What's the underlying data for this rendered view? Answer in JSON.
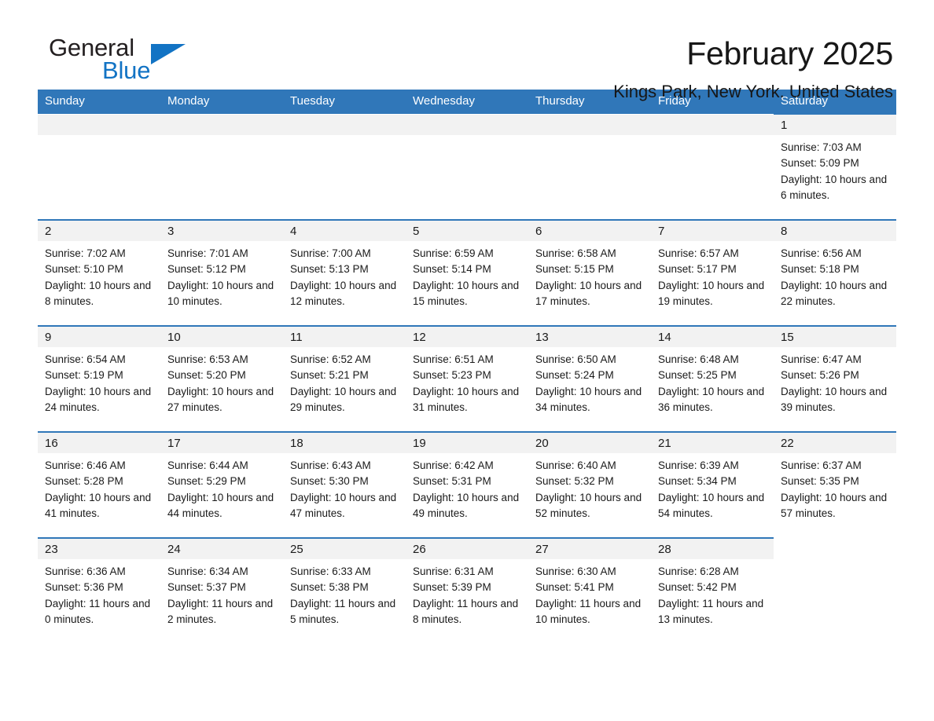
{
  "brand": {
    "name_part1": "General",
    "name_part2": "Blue",
    "accent_color": "#1273c4",
    "header_color": "#3077b9"
  },
  "header": {
    "title": "February 2025",
    "subtitle": "Kings Park, New York, United States"
  },
  "weekdays": [
    "Sunday",
    "Monday",
    "Tuesday",
    "Wednesday",
    "Thursday",
    "Friday",
    "Saturday"
  ],
  "labels": {
    "sunrise_prefix": "Sunrise:",
    "sunset_prefix": "Sunset:",
    "daylight_prefix": "Daylight:"
  },
  "weeks": [
    [
      {
        "day": "",
        "sunrise": "",
        "sunset": "",
        "daylight": "",
        "blank": true
      },
      {
        "day": "",
        "sunrise": "",
        "sunset": "",
        "daylight": "",
        "blank": true
      },
      {
        "day": "",
        "sunrise": "",
        "sunset": "",
        "daylight": "",
        "blank": true
      },
      {
        "day": "",
        "sunrise": "",
        "sunset": "",
        "daylight": "",
        "blank": true
      },
      {
        "day": "",
        "sunrise": "",
        "sunset": "",
        "daylight": "",
        "blank": true
      },
      {
        "day": "",
        "sunrise": "",
        "sunset": "",
        "daylight": "",
        "blank": true
      },
      {
        "day": "1",
        "sunrise": "Sunrise: 7:03 AM",
        "sunset": "Sunset: 5:09 PM",
        "daylight": "Daylight: 10 hours and 6 minutes."
      }
    ],
    [
      {
        "day": "2",
        "sunrise": "Sunrise: 7:02 AM",
        "sunset": "Sunset: 5:10 PM",
        "daylight": "Daylight: 10 hours and 8 minutes."
      },
      {
        "day": "3",
        "sunrise": "Sunrise: 7:01 AM",
        "sunset": "Sunset: 5:12 PM",
        "daylight": "Daylight: 10 hours and 10 minutes."
      },
      {
        "day": "4",
        "sunrise": "Sunrise: 7:00 AM",
        "sunset": "Sunset: 5:13 PM",
        "daylight": "Daylight: 10 hours and 12 minutes."
      },
      {
        "day": "5",
        "sunrise": "Sunrise: 6:59 AM",
        "sunset": "Sunset: 5:14 PM",
        "daylight": "Daylight: 10 hours and 15 minutes."
      },
      {
        "day": "6",
        "sunrise": "Sunrise: 6:58 AM",
        "sunset": "Sunset: 5:15 PM",
        "daylight": "Daylight: 10 hours and 17 minutes."
      },
      {
        "day": "7",
        "sunrise": "Sunrise: 6:57 AM",
        "sunset": "Sunset: 5:17 PM",
        "daylight": "Daylight: 10 hours and 19 minutes."
      },
      {
        "day": "8",
        "sunrise": "Sunrise: 6:56 AM",
        "sunset": "Sunset: 5:18 PM",
        "daylight": "Daylight: 10 hours and 22 minutes."
      }
    ],
    [
      {
        "day": "9",
        "sunrise": "Sunrise: 6:54 AM",
        "sunset": "Sunset: 5:19 PM",
        "daylight": "Daylight: 10 hours and 24 minutes."
      },
      {
        "day": "10",
        "sunrise": "Sunrise: 6:53 AM",
        "sunset": "Sunset: 5:20 PM",
        "daylight": "Daylight: 10 hours and 27 minutes."
      },
      {
        "day": "11",
        "sunrise": "Sunrise: 6:52 AM",
        "sunset": "Sunset: 5:21 PM",
        "daylight": "Daylight: 10 hours and 29 minutes."
      },
      {
        "day": "12",
        "sunrise": "Sunrise: 6:51 AM",
        "sunset": "Sunset: 5:23 PM",
        "daylight": "Daylight: 10 hours and 31 minutes."
      },
      {
        "day": "13",
        "sunrise": "Sunrise: 6:50 AM",
        "sunset": "Sunset: 5:24 PM",
        "daylight": "Daylight: 10 hours and 34 minutes."
      },
      {
        "day": "14",
        "sunrise": "Sunrise: 6:48 AM",
        "sunset": "Sunset: 5:25 PM",
        "daylight": "Daylight: 10 hours and 36 minutes."
      },
      {
        "day": "15",
        "sunrise": "Sunrise: 6:47 AM",
        "sunset": "Sunset: 5:26 PM",
        "daylight": "Daylight: 10 hours and 39 minutes."
      }
    ],
    [
      {
        "day": "16",
        "sunrise": "Sunrise: 6:46 AM",
        "sunset": "Sunset: 5:28 PM",
        "daylight": "Daylight: 10 hours and 41 minutes."
      },
      {
        "day": "17",
        "sunrise": "Sunrise: 6:44 AM",
        "sunset": "Sunset: 5:29 PM",
        "daylight": "Daylight: 10 hours and 44 minutes."
      },
      {
        "day": "18",
        "sunrise": "Sunrise: 6:43 AM",
        "sunset": "Sunset: 5:30 PM",
        "daylight": "Daylight: 10 hours and 47 minutes."
      },
      {
        "day": "19",
        "sunrise": "Sunrise: 6:42 AM",
        "sunset": "Sunset: 5:31 PM",
        "daylight": "Daylight: 10 hours and 49 minutes."
      },
      {
        "day": "20",
        "sunrise": "Sunrise: 6:40 AM",
        "sunset": "Sunset: 5:32 PM",
        "daylight": "Daylight: 10 hours and 52 minutes."
      },
      {
        "day": "21",
        "sunrise": "Sunrise: 6:39 AM",
        "sunset": "Sunset: 5:34 PM",
        "daylight": "Daylight: 10 hours and 54 minutes."
      },
      {
        "day": "22",
        "sunrise": "Sunrise: 6:37 AM",
        "sunset": "Sunset: 5:35 PM",
        "daylight": "Daylight: 10 hours and 57 minutes."
      }
    ],
    [
      {
        "day": "23",
        "sunrise": "Sunrise: 6:36 AM",
        "sunset": "Sunset: 5:36 PM",
        "daylight": "Daylight: 11 hours and 0 minutes."
      },
      {
        "day": "24",
        "sunrise": "Sunrise: 6:34 AM",
        "sunset": "Sunset: 5:37 PM",
        "daylight": "Daylight: 11 hours and 2 minutes."
      },
      {
        "day": "25",
        "sunrise": "Sunrise: 6:33 AM",
        "sunset": "Sunset: 5:38 PM",
        "daylight": "Daylight: 11 hours and 5 minutes."
      },
      {
        "day": "26",
        "sunrise": "Sunrise: 6:31 AM",
        "sunset": "Sunset: 5:39 PM",
        "daylight": "Daylight: 11 hours and 8 minutes."
      },
      {
        "day": "27",
        "sunrise": "Sunrise: 6:30 AM",
        "sunset": "Sunset: 5:41 PM",
        "daylight": "Daylight: 11 hours and 10 minutes."
      },
      {
        "day": "28",
        "sunrise": "Sunrise: 6:28 AM",
        "sunset": "Sunset: 5:42 PM",
        "daylight": "Daylight: 11 hours and 13 minutes."
      },
      {
        "day": "",
        "sunrise": "",
        "sunset": "",
        "daylight": "",
        "blank": true
      }
    ]
  ]
}
